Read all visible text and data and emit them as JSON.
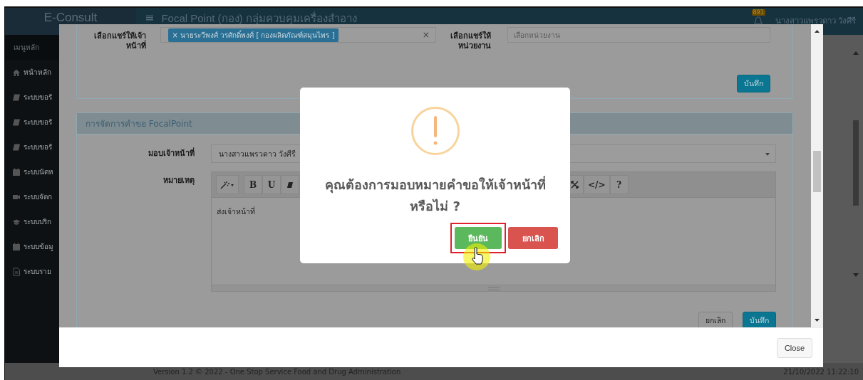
{
  "header": {
    "brand": "E-Consult",
    "menu_icon": "≡",
    "title": "Focal Point (กอง) กลุ่มควบคุมเครื่องสำอาง",
    "notification_count": "891",
    "user": "นางสาวแพรวดาว วังศีรี"
  },
  "sidebar": {
    "heading": "เมนูหลัก",
    "items": [
      {
        "kind": "home",
        "label": "หน้าหลัก"
      },
      {
        "kind": "book",
        "label": "ระบบขอรั"
      },
      {
        "kind": "book",
        "label": "ระบบขอรั"
      },
      {
        "kind": "book",
        "label": "ระบบขอรั"
      },
      {
        "kind": "calendar",
        "label": "ระบบนัดห"
      },
      {
        "kind": "video",
        "label": "ระบบจัดก"
      },
      {
        "kind": "graduation",
        "label": "ระบบบริก"
      },
      {
        "kind": "calendar",
        "label": "ระบบข้อมู"
      },
      {
        "kind": "file",
        "label": "ระบบราย"
      }
    ]
  },
  "modal": {
    "share_panel": {
      "staff_label": "เลือกแชร์ให้เจ้าหน้าที่",
      "staff_tags": [
        "× นายระวีพงศ์ วรศักดิ์พงศ์ [ กองผลิตภัณฑ์สมุนไพร ]"
      ],
      "clear_icon": "×",
      "unit_label": "เลือกแชร์ให้หน่วยงาน",
      "unit_placeholder": "เลือกหน่วยงาน",
      "save_button": "บันทึก"
    },
    "request_panel": {
      "title": "การจัดการคำขอ FocalPoint",
      "assign_label": "มอบเจ้าหน้าที่",
      "assign_value": "นางสาวแพรวดาว วังศีรี",
      "note_label": "หมายเหตุ",
      "toolbar_left": [
        {
          "kind": "wand"
        },
        {
          "kind": "text",
          "label": "B"
        },
        {
          "kind": "text",
          "label": "U"
        },
        {
          "kind": "eraser"
        }
      ],
      "toolbar_right": [
        {
          "kind": "fullscreen"
        },
        {
          "kind": "text",
          "label": "</>"
        },
        {
          "kind": "text",
          "label": "?"
        }
      ],
      "note_text": "ส่งเจ้าหน้าที่",
      "cancel_button": "ยกเลิก",
      "save_button": "บันทึก"
    },
    "close_button": "Close"
  },
  "dialog": {
    "message": "คุณต้องการมอบหมายคำขอให้เจ้าหน้าที่หรือไม่ ?",
    "confirm_button": "ยืนยัน",
    "confirm_highlighted": true,
    "cancel_button": "ยกเลิก"
  },
  "footer": {
    "version": "Version 1.2 © 2022 - One Stop Service Food and Drug Administration",
    "timestamp": "21/10/2022 11:22:10"
  }
}
